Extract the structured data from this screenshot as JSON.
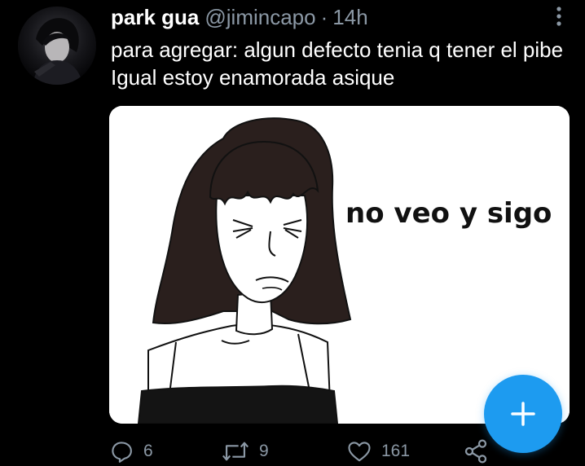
{
  "tweet": {
    "display_name": "park gua",
    "handle": "@jimincapo",
    "separator": "·",
    "time": "14h",
    "text": "para agregar: algun defecto tenia q tener el pibe Igual estoy enamorada asique",
    "media": {
      "caption": "no veo y sigo"
    }
  },
  "actions": {
    "reply_count": "6",
    "retweet_count": "9",
    "like_count": "161"
  },
  "icons": {
    "more": "more-vertical-icon",
    "reply": "reply-icon",
    "retweet": "retweet-icon",
    "like": "heart-icon",
    "share": "share-icon",
    "compose": "plus-icon"
  },
  "colors": {
    "background": "#000000",
    "text_primary": "#ffffff",
    "text_secondary": "#8b98a5",
    "accent": "#1d9bf0"
  }
}
